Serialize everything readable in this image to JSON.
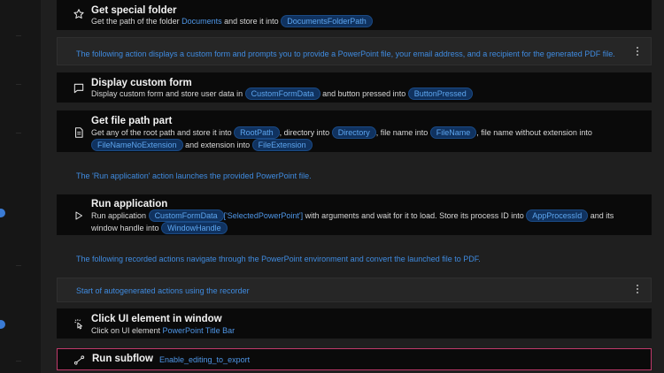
{
  "actions": {
    "special_folder": {
      "title": "Get special folder",
      "desc_pre": "Get the path of the folder",
      "folder_link": "Documents",
      "desc_mid": "and store it into",
      "var": "DocumentsFolderPath"
    },
    "custom_form": {
      "title": "Display custom form",
      "desc_pre": "Display custom form and store user data in",
      "var1": "CustomFormData",
      "desc_mid": "and button pressed into",
      "var2": "ButtonPressed"
    },
    "file_path": {
      "title": "Get file path part",
      "desc_1": "Get any of the root path and store it into",
      "var_root": "RootPath",
      "desc_2": ", directory into",
      "var_dir": "Directory",
      "desc_3": ", file name into",
      "var_name": "FileName",
      "desc_4": ", file name without extension into",
      "var_noext": "FileNameNoExtension",
      "desc_5": "and extension into",
      "var_ext": "FileExtension"
    },
    "run_app": {
      "title": "Run application",
      "desc_1": "Run application",
      "var_form": "CustomFormData",
      "desc_key": "['SelectedPowerPoint']",
      "desc_2": "with arguments  and wait for it to load. Store its process ID into",
      "var_pid": "AppProcessId",
      "desc_3": "and its window handle into",
      "var_handle": "WindowHandle"
    },
    "click_ui": {
      "title": "Click UI element in window",
      "desc_pre": "Click on UI element",
      "element_link": "PowerPoint Title Bar"
    },
    "subflow": {
      "title": "Run subflow",
      "name": "Enable_editing_to_export"
    }
  },
  "comments": {
    "form_note": "The following action displays a custom form and prompts you to provide a PowerPoint file, your email address, and a recipient for the generated PDF file.",
    "run_note": "The 'Run application' action launches the provided PowerPoint file.",
    "recorded_note": "The following recorded actions navigate through the PowerPoint environment and convert the launched file to PDF.",
    "autogen_note": "Start of autogenerated actions using the recorder"
  },
  "colors": {
    "accent": "#4f97e8",
    "variable_bg": "#10325f",
    "subflow_border": "#c0396b"
  },
  "icons": {
    "special_folder": "star-icon",
    "custom_form": "message-icon",
    "file_path": "file-icon",
    "run_app": "play-icon",
    "click_ui": "click-icon",
    "subflow": "subflow-icon",
    "more": "kebab-icon"
  }
}
